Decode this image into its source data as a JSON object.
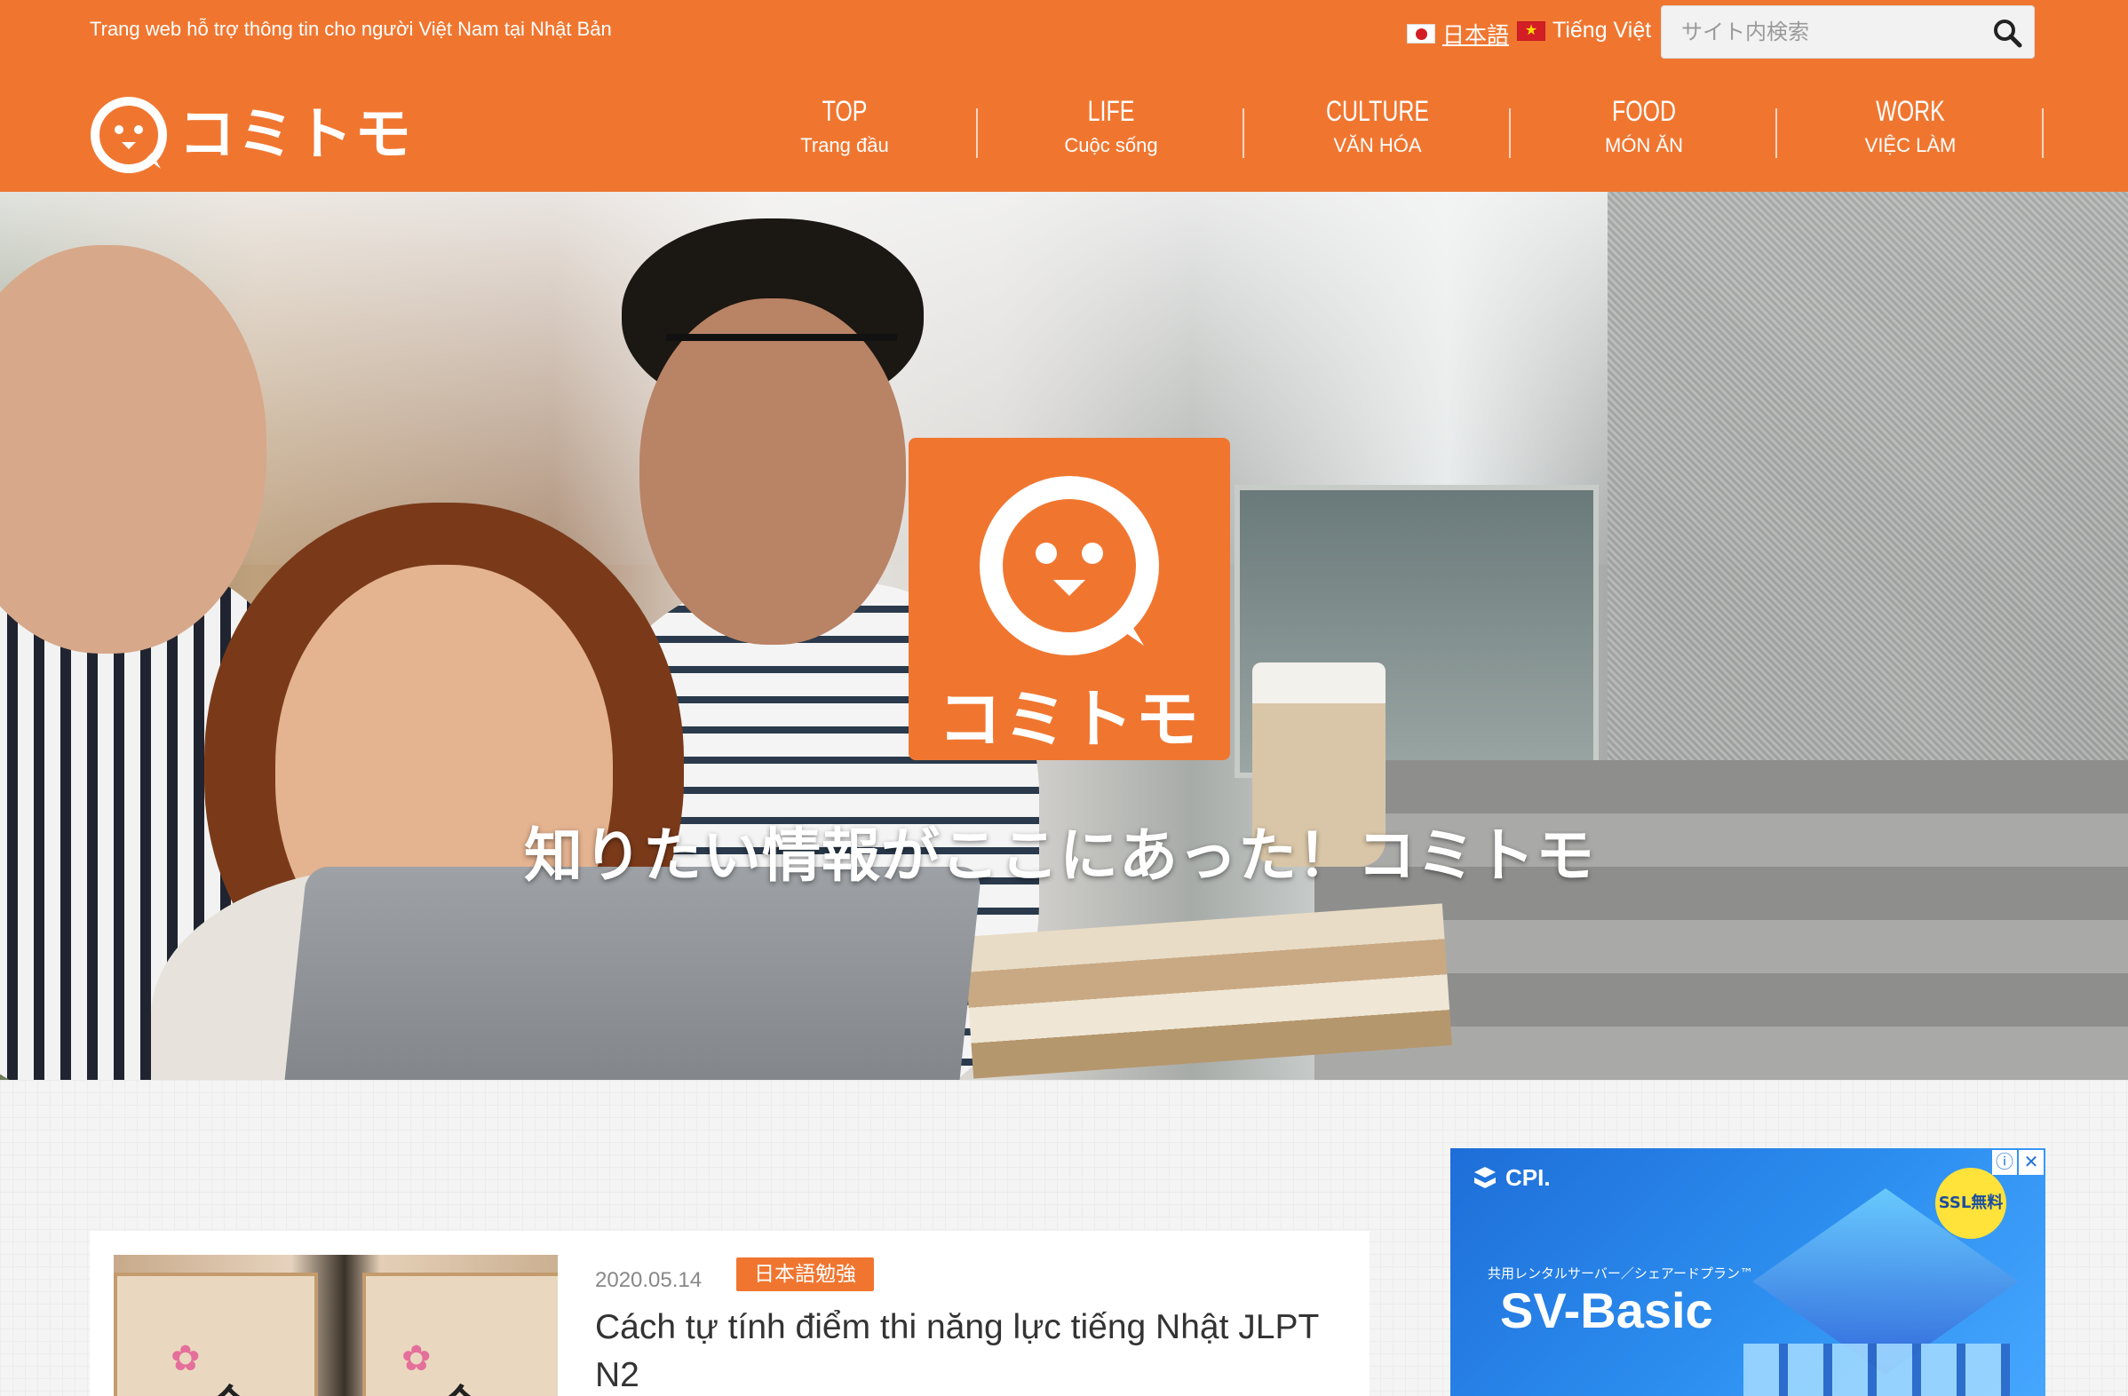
{
  "header": {
    "tagline": "Trang web hỗ trợ thông tin cho người Việt Nam tại Nhật Bản",
    "lang_ja": "日本語",
    "lang_vi": "Tiếng Việt",
    "search_placeholder": "サイト内検索",
    "logo_text": "コミトモ",
    "brand_color": "#f07630"
  },
  "nav": [
    {
      "en": "TOP",
      "vi": "Trang đầu"
    },
    {
      "en": "LIFE",
      "vi": "Cuộc sống"
    },
    {
      "en": "CULTURE",
      "vi": "VĂN HÓA"
    },
    {
      "en": "FOOD",
      "vi": "MÓN ĂN"
    },
    {
      "en": "WORK",
      "vi": "VIỆC LÀM"
    }
  ],
  "hero": {
    "logo_text": "コミトモ",
    "tagline": "知りたい情報がここにあった！コミトモ"
  },
  "post": {
    "date": "2020.05.14",
    "category": "日本語勉強",
    "title": "Cách tự tính điểm thi năng lực tiếng Nhật JLPT N2",
    "thumb_kanji": "合"
  },
  "ad": {
    "brand": "CPI.",
    "subtitle": "共用レンタルサーバー／シェアードプラン™",
    "product": "SV-Basic",
    "ssl_badge": "SSL無料",
    "info_icon": "ⓘ",
    "close_icon": "✕"
  }
}
